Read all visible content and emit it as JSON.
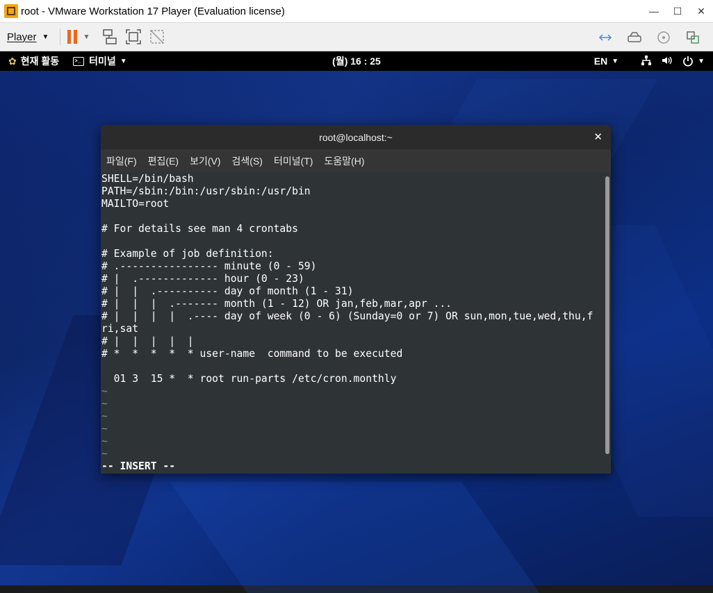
{
  "host": {
    "window_title": "root - VMware Workstation 17 Player (Evaluation license)",
    "player_menu_label": "Player",
    "controls": {
      "minimize": "—",
      "maximize": "☐",
      "close": "✕"
    }
  },
  "guest_top_bar": {
    "activities_label": "현재 활동",
    "app_menu_label": "터미널",
    "clock": "(월) 16 : 25",
    "language": "EN"
  },
  "terminal": {
    "title": "root@localhost:~",
    "close_glyph": "✕",
    "menu": [
      "파일(F)",
      "편집(E)",
      "보기(V)",
      "검색(S)",
      "터미널(T)",
      "도움말(H)"
    ],
    "lines": [
      "SHELL=/bin/bash",
      "PATH=/sbin:/bin:/usr/sbin:/usr/bin",
      "MAILTO=root",
      "",
      "# For details see man 4 crontabs",
      "",
      "# Example of job definition:",
      "# .---------------- minute (0 - 59)",
      "# |  .------------- hour (0 - 23)",
      "# |  |  .---------- day of month (1 - 31)",
      "# |  |  |  .------- month (1 - 12) OR jan,feb,mar,apr ...",
      "# |  |  |  |  .---- day of week (0 - 6) (Sunday=0 or 7) OR sun,mon,tue,wed,thu,f",
      "ri,sat",
      "# |  |  |  |  |",
      "# *  *  *  *  * user-name  command to be executed",
      "",
      "  01 3  15 *  * root run-parts /etc/cron.monthly"
    ],
    "tildes": [
      "~",
      "~",
      "~",
      "~",
      "~",
      "~"
    ],
    "status_line": "-- INSERT --"
  }
}
